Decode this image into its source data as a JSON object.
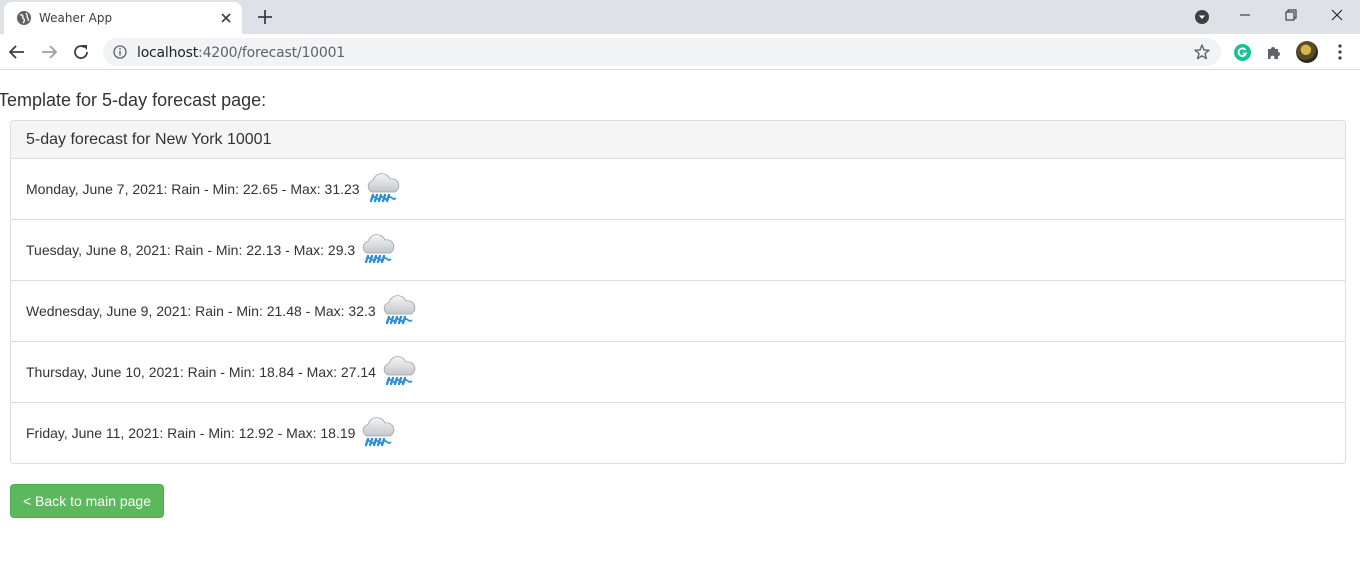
{
  "browser": {
    "tab_title": "Weaher App",
    "url_host": "localhost",
    "url_rest": ":4200/forecast/10001"
  },
  "page": {
    "heading": "Template for 5-day forecast page:",
    "panel_title": "5-day forecast for New York 10001",
    "forecast": [
      {
        "text": "Monday, June 7, 2021: Rain - Min: 22.65 - Max: 31.23",
        "icon": "rain-cloud-icon"
      },
      {
        "text": "Tuesday, June 8, 2021: Rain - Min: 22.13 - Max: 29.3",
        "icon": "rain-cloud-icon"
      },
      {
        "text": "Wednesday, June 9, 2021: Rain - Min: 21.48 - Max: 32.3",
        "icon": "rain-cloud-icon"
      },
      {
        "text": "Thursday, June 10, 2021: Rain - Min: 18.84 - Max: 27.14",
        "icon": "rain-cloud-icon"
      },
      {
        "text": "Friday, June 11, 2021: Rain - Min: 12.92 - Max: 18.19",
        "icon": "rain-cloud-icon"
      }
    ],
    "back_button": "< Back to main page"
  },
  "colors": {
    "button_green": "#5cb85c",
    "panel_heading_bg": "#f5f5f5",
    "tabstrip_bg": "#dee1e6"
  }
}
